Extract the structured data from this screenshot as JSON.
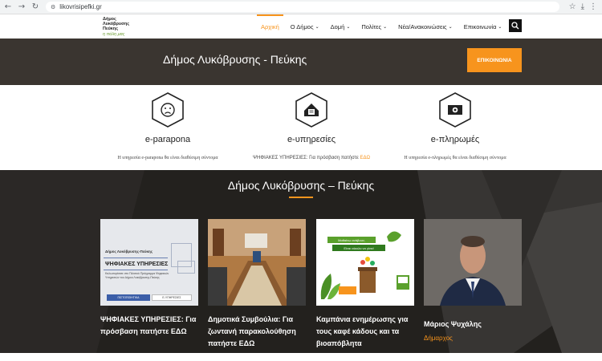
{
  "browser": {
    "url": "likovrisipefki.gr"
  },
  "logo": {
    "line1": "Δήμος",
    "line2": "Λυκόβρυσης",
    "line3": "Πεύκης",
    "tagline": "η πόλη μας"
  },
  "menu": [
    {
      "label": "Αρχική",
      "active": true,
      "dropdown": false
    },
    {
      "label": "Ο Δήμος",
      "active": false,
      "dropdown": true
    },
    {
      "label": "Δομή",
      "active": false,
      "dropdown": true
    },
    {
      "label": "Πολίτες",
      "active": false,
      "dropdown": true
    },
    {
      "label": "Νέα/Ανακοινώσεις",
      "active": false,
      "dropdown": true
    },
    {
      "label": "Επικοινωνία",
      "active": false,
      "dropdown": true
    }
  ],
  "hero": {
    "title": "Δήμος Λυκόβρυσης - Πεύκης",
    "button": "ΕΠΙΚΟΙΝΩΝΙΑ"
  },
  "services": [
    {
      "title": "e-parapona",
      "desc": "Η υπηρεσία e-parapona θα είναι διαθέσιμη σύντομα",
      "link": "",
      "icon": "sad-face-icon"
    },
    {
      "title": "e-υπηρεσίες",
      "desc": "ΨΗΦΙΑΚΕΣ ΥΠΗΡΕΣΙΕΣ: Για πρόσβαση πατήστε ",
      "link": "ΕΔΩ",
      "icon": "home-document-icon"
    },
    {
      "title": "e-πληρωμές",
      "desc": "Η υπηρεσία e-πληρωμές θα είναι διαθέσιμη σύντομα",
      "link": "",
      "icon": "money-icon"
    }
  ],
  "news": {
    "title": "Δήμος Λυκόβρυσης – Πεύκης",
    "cards": [
      {
        "title": "ΨΗΦΙΑΚΕΣ ΥΠΗΡΕΣΙΕΣ: Για πρόσβαση πατήστε ΕΔΩ",
        "thumb": {
          "line1": "Δήμος Λυκόβρυσης-Πεύκης",
          "line2": "ΨΗΦΙΑΚΕΣ ΥΠΗΡΕΣΙΕΣ",
          "line3": "Καλωσορίσατε στο Πιλοτικό Πρόγραμμα Ψηφιακών Υπηρεσιών του Δήμου Λυκόβρυσης-Πεύκης",
          "btn1": "ΠΙΣΤΟΠΟΙΗΤΙΚΑ",
          "btn2": "Ε-ΥΠΗΡΕΣΙΕΣ"
        }
      },
      {
        "title": "Δημοτικά Συμβούλια: Για ζωντανή παρακολούθηση πατήστε ΕΔΩ"
      },
      {
        "title": "Καμπάνια ενημέρωσης για τους καφέ κάδους και τα βιοαπόβλητα",
        "thumb": {
          "line1": "Μαθαίνω ανάβουν,",
          "line2": "Είναι εύκολο να γίνει!"
        }
      },
      {
        "title": "Μάριος Ψυχάλης",
        "subtitle": "Δήμαρχος"
      }
    ]
  },
  "colors": {
    "accent": "#f7941d",
    "dark": "#3a3530",
    "green": "#6a9c2f"
  }
}
